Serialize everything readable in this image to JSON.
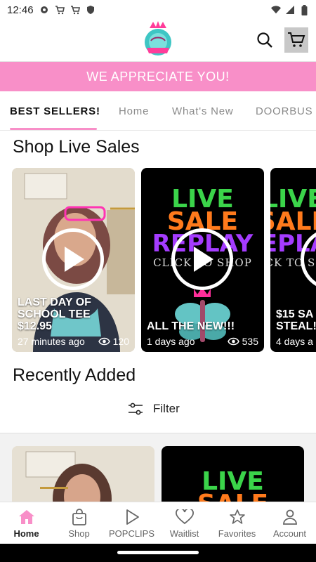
{
  "status_bar": {
    "time": "12:46",
    "left_icons": [
      "gear-icon",
      "cart-icon",
      "cart-icon",
      "shield-icon"
    ],
    "right_icons": [
      "wifi-icon",
      "signal-icon",
      "battery-icon"
    ]
  },
  "header": {
    "logo_icon": "brand-logo",
    "search_icon": "search-icon",
    "cart_icon": "cart-icon"
  },
  "banner": {
    "text": "WE APPRECIATE YOU!",
    "color": "#f88fc8"
  },
  "tabs": [
    {
      "label": "BEST SELLERS!",
      "active": true
    },
    {
      "label": "Home",
      "active": false
    },
    {
      "label": "What's New",
      "active": false
    },
    {
      "label": "DOORBUS",
      "active": false
    }
  ],
  "live_sales": {
    "title": "Shop Live Sales",
    "cards": [
      {
        "caption_lines": [
          "LAST DAY OF",
          "SCHOOL TEE",
          "$12.95"
        ],
        "time": "27 minutes ago",
        "views": "120"
      },
      {
        "art_lines": [
          "LIVE",
          "SALE",
          "REPLAY"
        ],
        "art_subtitle": "CLICK TO SHOP",
        "caption_lines": [
          "ALL THE NEW!!!"
        ],
        "time": "1 days ago",
        "views": "535"
      },
      {
        "art_lines": [
          "LIVE",
          "SALE",
          "REPLAY"
        ],
        "art_subtitle": "CLICK TO SHOP",
        "caption_lines": [
          "$15 SA",
          "STEAL!"
        ],
        "time": "4 days a",
        "views": ""
      }
    ]
  },
  "recently_added": {
    "title": "Recently Added",
    "filter_label": "Filter",
    "filter_icon": "sliders-icon",
    "tile_art": [
      "LIVE",
      "SALE"
    ]
  },
  "bottom_nav": [
    {
      "label": "Home",
      "icon": "home-icon",
      "active": true
    },
    {
      "label": "Shop",
      "icon": "shopping-bag-icon",
      "active": false
    },
    {
      "label": "POPCLIPS",
      "icon": "play-icon",
      "active": false
    },
    {
      "label": "Waitlist",
      "icon": "heart-icon",
      "active": false
    },
    {
      "label": "Favorites",
      "icon": "star-icon",
      "active": false
    },
    {
      "label": "Account",
      "icon": "person-icon",
      "active": false
    }
  ],
  "colors": {
    "accent": "#f88fc8",
    "live_green": "#3bd44a",
    "live_orange": "#ff7a1c",
    "live_purple": "#a53cff",
    "live_pink": "#ff2e9a"
  }
}
